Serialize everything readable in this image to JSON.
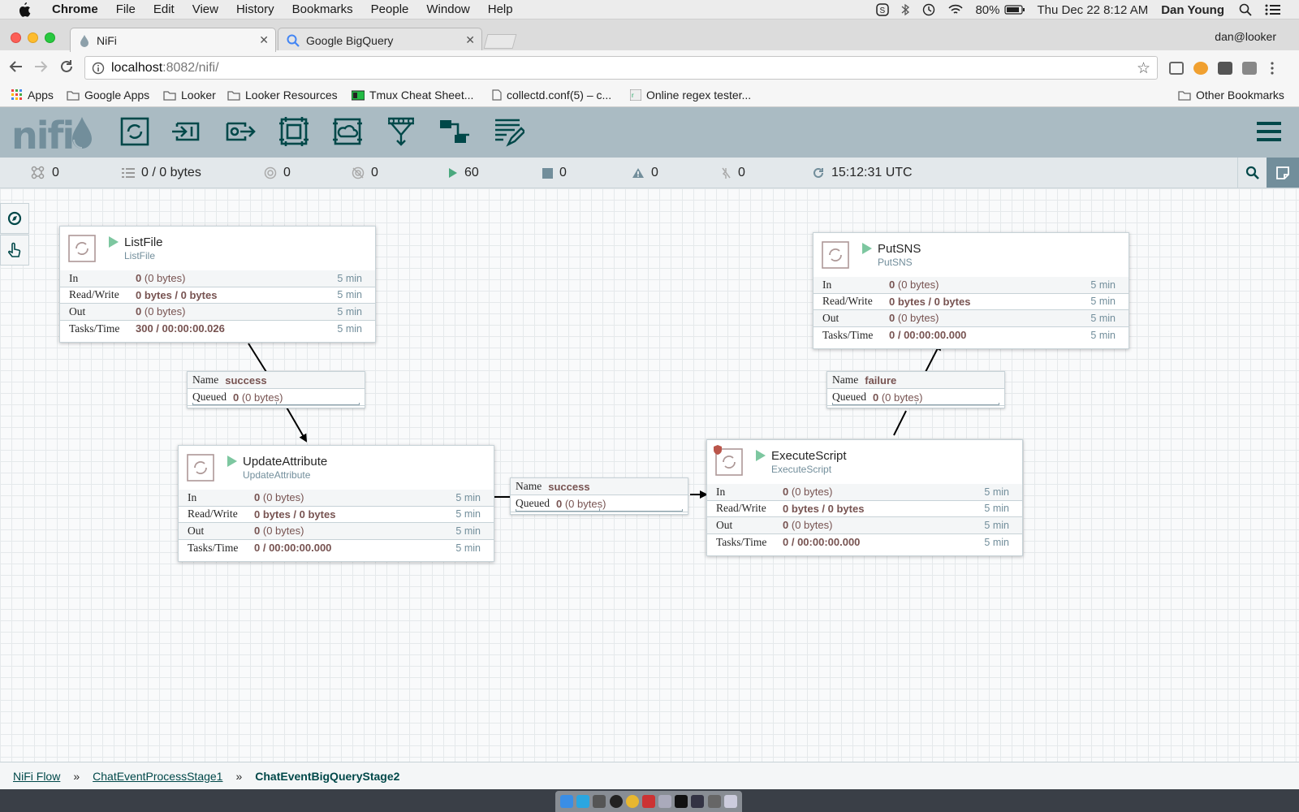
{
  "macos": {
    "app_name": "Chrome",
    "menus": [
      "File",
      "Edit",
      "View",
      "History",
      "Bookmarks",
      "People",
      "Window",
      "Help"
    ],
    "battery": "80%",
    "datetime": "Thu Dec 22  8:12 AM",
    "user": "Dan Young"
  },
  "browser": {
    "tabs": [
      {
        "title": "NiFi",
        "active": true
      },
      {
        "title": "Google BigQuery",
        "active": false
      }
    ],
    "profile": "dan@looker",
    "url_host": "localhost",
    "url_path": ":8082/nifi/",
    "bookmarks": [
      "Apps",
      "Google Apps",
      "Looker",
      "Looker Resources",
      "Tmux Cheat Sheet...",
      "collectd.conf(5) – c...",
      "Online regex tester..."
    ],
    "other_bookmarks": "Other Bookmarks"
  },
  "nifi": {
    "logo": "nifi",
    "status": {
      "active_threads": "0",
      "queued": "0 / 0 bytes",
      "transmitting": "0",
      "not_transmitting": "0",
      "running": "60",
      "stopped": "0",
      "invalid": "0",
      "disabled": "0",
      "last_refreshed": "15:12:31 UTC"
    },
    "row_labels": {
      "in": "In",
      "rw": "Read/Write",
      "out": "Out",
      "tasks": "Tasks/Time"
    },
    "conn_labels": {
      "name": "Name",
      "queued": "Queued"
    },
    "processors": {
      "listfile": {
        "name": "ListFile",
        "type": "ListFile",
        "in": "0",
        "in_bytes": "(0 bytes)",
        "rw": "0 bytes / 0 bytes",
        "out": "0",
        "out_bytes": "(0 bytes)",
        "tasks": "300 / 00:00:00.026",
        "window": "5 min"
      },
      "putsns": {
        "name": "PutSNS",
        "type": "PutSNS",
        "in": "0",
        "in_bytes": "(0 bytes)",
        "rw": "0 bytes / 0 bytes",
        "out": "0",
        "out_bytes": "(0 bytes)",
        "tasks": "0 / 00:00:00.000",
        "window": "5 min"
      },
      "updateattribute": {
        "name": "UpdateAttribute",
        "type": "UpdateAttribute",
        "in": "0",
        "in_bytes": "(0 bytes)",
        "rw": "0 bytes / 0 bytes",
        "out": "0",
        "out_bytes": "(0 bytes)",
        "tasks": "0 / 00:00:00.000",
        "window": "5 min"
      },
      "executescript": {
        "name": "ExecuteScript",
        "type": "ExecuteScript",
        "in": "0",
        "in_bytes": "(0 bytes)",
        "rw": "0 bytes / 0 bytes",
        "out": "0",
        "out_bytes": "(0 bytes)",
        "tasks": "0 / 00:00:00.000",
        "window": "5 min"
      }
    },
    "connections": {
      "c1": {
        "name": "success",
        "queued": "0",
        "queued_bytes": "(0 bytes)"
      },
      "c2": {
        "name": "success",
        "queued": "0",
        "queued_bytes": "(0 bytes)"
      },
      "c3": {
        "name": "failure",
        "queued": "0",
        "queued_bytes": "(0 bytes)"
      }
    },
    "breadcrumbs": [
      "NiFi Flow",
      "ChatEventProcessStage1",
      "ChatEventBigQueryStage2"
    ]
  },
  "colors": {
    "header": "#aabbc3",
    "run_green": "#7dc7a0",
    "value_brown": "#775351",
    "link_teal": "#004849"
  }
}
